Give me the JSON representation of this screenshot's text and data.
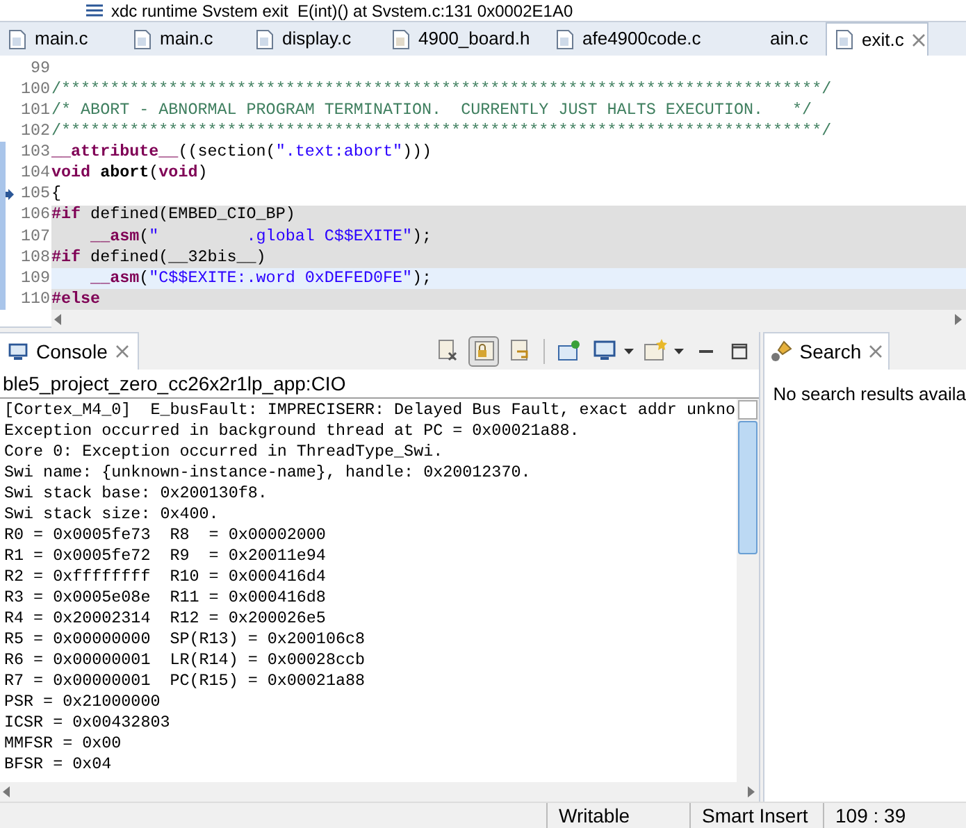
{
  "stack_frame": {
    "text": "xdc runtime Svstem exit  E(int)() at Svstem.c:131 0x0002E1A0"
  },
  "tabs": [
    {
      "label": "main.c",
      "kind": "c",
      "selected": false
    },
    {
      "label": "main.c",
      "kind": "c",
      "selected": false
    },
    {
      "label": "display.c",
      "kind": "c",
      "selected": false
    },
    {
      "label": "4900_board.h",
      "kind": "h",
      "selected": false
    },
    {
      "label": "afe4900code.c",
      "kind": "c",
      "selected": false
    },
    {
      "label": "ain.c",
      "kind": "none",
      "selected": false
    },
    {
      "label": "exit.c",
      "kind": "c",
      "selected": true
    }
  ],
  "editor": {
    "lines": [
      {
        "number": "99",
        "inactive": false,
        "current": false,
        "ruler": false,
        "pointer": false
      },
      {
        "number": "100",
        "inactive": false,
        "current": false,
        "ruler": false,
        "pointer": false,
        "segments": [
          {
            "kind": "comment",
            "text": "/******************************************************************************/"
          }
        ]
      },
      {
        "number": "101",
        "inactive": false,
        "current": false,
        "ruler": false,
        "pointer": false,
        "segments": [
          {
            "kind": "comment",
            "text": "/* ABORT - ABNORMAL PROGRAM TERMINATION.  CURRENTLY JUST HALTS EXECUTION.   */"
          }
        ]
      },
      {
        "number": "102",
        "inactive": false,
        "current": false,
        "ruler": false,
        "pointer": false,
        "segments": [
          {
            "kind": "comment",
            "text": "/******************************************************************************/"
          }
        ]
      },
      {
        "number": "103",
        "inactive": false,
        "current": false,
        "ruler": true,
        "pointer": false,
        "segments": [
          {
            "kind": "keyword",
            "text": "__attribute__"
          },
          {
            "kind": "plain",
            "text": "((section("
          },
          {
            "kind": "string",
            "text": "\".text:abort\""
          },
          {
            "kind": "plain",
            "text": ")))"
          }
        ]
      },
      {
        "number": "104",
        "inactive": false,
        "current": false,
        "ruler": true,
        "pointer": false,
        "segments": [
          {
            "kind": "keyword",
            "text": "void"
          },
          {
            "kind": "bold",
            "text": " abort"
          },
          {
            "kind": "plain",
            "text": "("
          },
          {
            "kind": "keyword",
            "text": "void"
          },
          {
            "kind": "plain",
            "text": ")"
          }
        ]
      },
      {
        "number": "105",
        "inactive": false,
        "current": false,
        "ruler": true,
        "pointer": true,
        "segments": [
          {
            "kind": "plain",
            "text": "{"
          }
        ]
      },
      {
        "number": "106",
        "inactive": true,
        "current": false,
        "ruler": true,
        "pointer": false,
        "segments": [
          {
            "kind": "keyword",
            "text": "#if"
          },
          {
            "kind": "plain",
            "text": " defined(EMBED_CIO_BP)"
          }
        ]
      },
      {
        "number": "107",
        "inactive": true,
        "current": false,
        "ruler": true,
        "pointer": false,
        "segments": [
          {
            "kind": "keyword",
            "text": "    __asm"
          },
          {
            "kind": "plain",
            "text": "("
          },
          {
            "kind": "string",
            "text": "\"         .global C$$EXITE\""
          },
          {
            "kind": "plain",
            "text": ");"
          }
        ]
      },
      {
        "number": "108",
        "inactive": true,
        "current": false,
        "ruler": true,
        "pointer": false,
        "segments": [
          {
            "kind": "keyword",
            "text": "#if"
          },
          {
            "kind": "plain",
            "text": " defined(__32bis__)"
          }
        ]
      },
      {
        "number": "109",
        "inactive": true,
        "current": true,
        "ruler": true,
        "pointer": false,
        "segments": [
          {
            "kind": "keyword",
            "text": "    __asm"
          },
          {
            "kind": "plain",
            "text": "("
          },
          {
            "kind": "string",
            "text": "\"C$$EXITE:.word 0xDEFED0FE\""
          },
          {
            "kind": "plain",
            "text": ");"
          }
        ]
      },
      {
        "number": "110",
        "inactive": true,
        "current": false,
        "ruler": true,
        "pointer": false,
        "segments": [
          {
            "kind": "keyword",
            "text": "#else"
          }
        ]
      }
    ]
  },
  "console": {
    "tab": "Console",
    "toolbar": [
      {
        "kind": "clear",
        "selected": false
      },
      {
        "kind": "scroll_lock",
        "selected": true
      },
      {
        "kind": "word_wrap",
        "selected": false
      },
      {
        "kind": "pin",
        "selected": false
      },
      {
        "kind": "display",
        "selected": false
      },
      {
        "kind": "new",
        "selected": false
      }
    ],
    "name": "ble5_project_zero_cc26x2r1lp_app:CIO",
    "lines": [
      "[Cortex_M4_0]  E_busFault: IMPRECISERR: Delayed Bus Fault, exact addr unkno",
      "Exception occurred in background thread at PC = 0x00021a88.",
      "Core 0: Exception occurred in ThreadType_Swi.",
      "Swi name: {unknown-instance-name}, handle: 0x20012370.",
      "Swi stack base: 0x200130f8.",
      "Swi stack size: 0x400.",
      "R0 = 0x0005fe73  R8  = 0x00002000",
      "R1 = 0x0005fe72  R9  = 0x20011e94",
      "R2 = 0xffffffff  R10 = 0x000416d4",
      "R3 = 0x0005e08e  R11 = 0x000416d8",
      "R4 = 0x20002314  R12 = 0x200026e5",
      "R5 = 0x00000000  SP(R13) = 0x200106c8",
      "R6 = 0x00000001  LR(R14) = 0x00028ccb",
      "R7 = 0x00000001  PC(R15) = 0x00021a88",
      "PSR = 0x21000000",
      "ICSR = 0x00432803",
      "MMFSR = 0x00",
      "BFSR = 0x04"
    ]
  },
  "search": {
    "tab": "Search",
    "message": "No search results availa"
  },
  "status_bar": [
    "Writable",
    "Smart Insert",
    "109 : 39"
  ]
}
